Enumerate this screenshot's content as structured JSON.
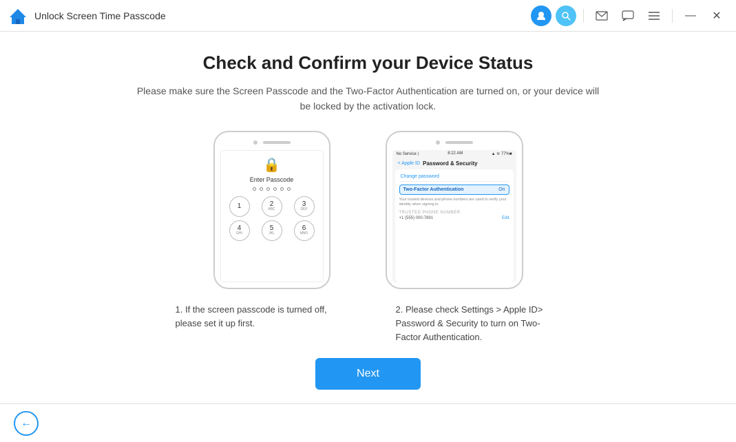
{
  "titlebar": {
    "title": "Unlock Screen Time Passcode",
    "app_icon": "house-icon"
  },
  "toolbar": {
    "avatar_icon": "👤",
    "search_icon": "🔍",
    "mail_icon": "✉",
    "chat_icon": "💬",
    "menu_icon": "☰",
    "minimize_icon": "—",
    "close_icon": "✕"
  },
  "page": {
    "title": "Check and Confirm your Device Status",
    "subtitle": "Please make sure the Screen Passcode and the Two-Factor Authentication are turned on, or your device will be locked by the activation lock.",
    "caption1": "1. If the screen passcode is turned off, please set it up first.",
    "caption2": "2. Please check Settings > Apple ID> Password & Security to turn on Two-Factor Authentication.",
    "next_button": "Next"
  },
  "phone1": {
    "enter_passcode": "Enter Passcode",
    "keys": [
      {
        "num": "1",
        "letters": ""
      },
      {
        "num": "2",
        "letters": "ABC"
      },
      {
        "num": "3",
        "letters": "DEF"
      },
      {
        "num": "4",
        "letters": "GHI"
      },
      {
        "num": "5",
        "letters": "JKL"
      },
      {
        "num": "6",
        "letters": "MNO"
      }
    ]
  },
  "phone2": {
    "status_left": "No Service ⟩",
    "status_time": "8:22 AM",
    "status_right": "▲ ≋ 77%■",
    "back_label": "< Apple ID",
    "header_title": "Password & Security",
    "change_password": "Change password",
    "two_factor_label": "Two-Factor Authentication",
    "two_factor_status": "On",
    "desc_text": "Your trusted devices and phone numbers are used to verify your identity when signing in.",
    "trusted_label": "TRUSTED PHONE NUMBER",
    "edit_label": "Edit",
    "phone_number": "+1 (555) 000-7891"
  },
  "back_button_label": "←"
}
